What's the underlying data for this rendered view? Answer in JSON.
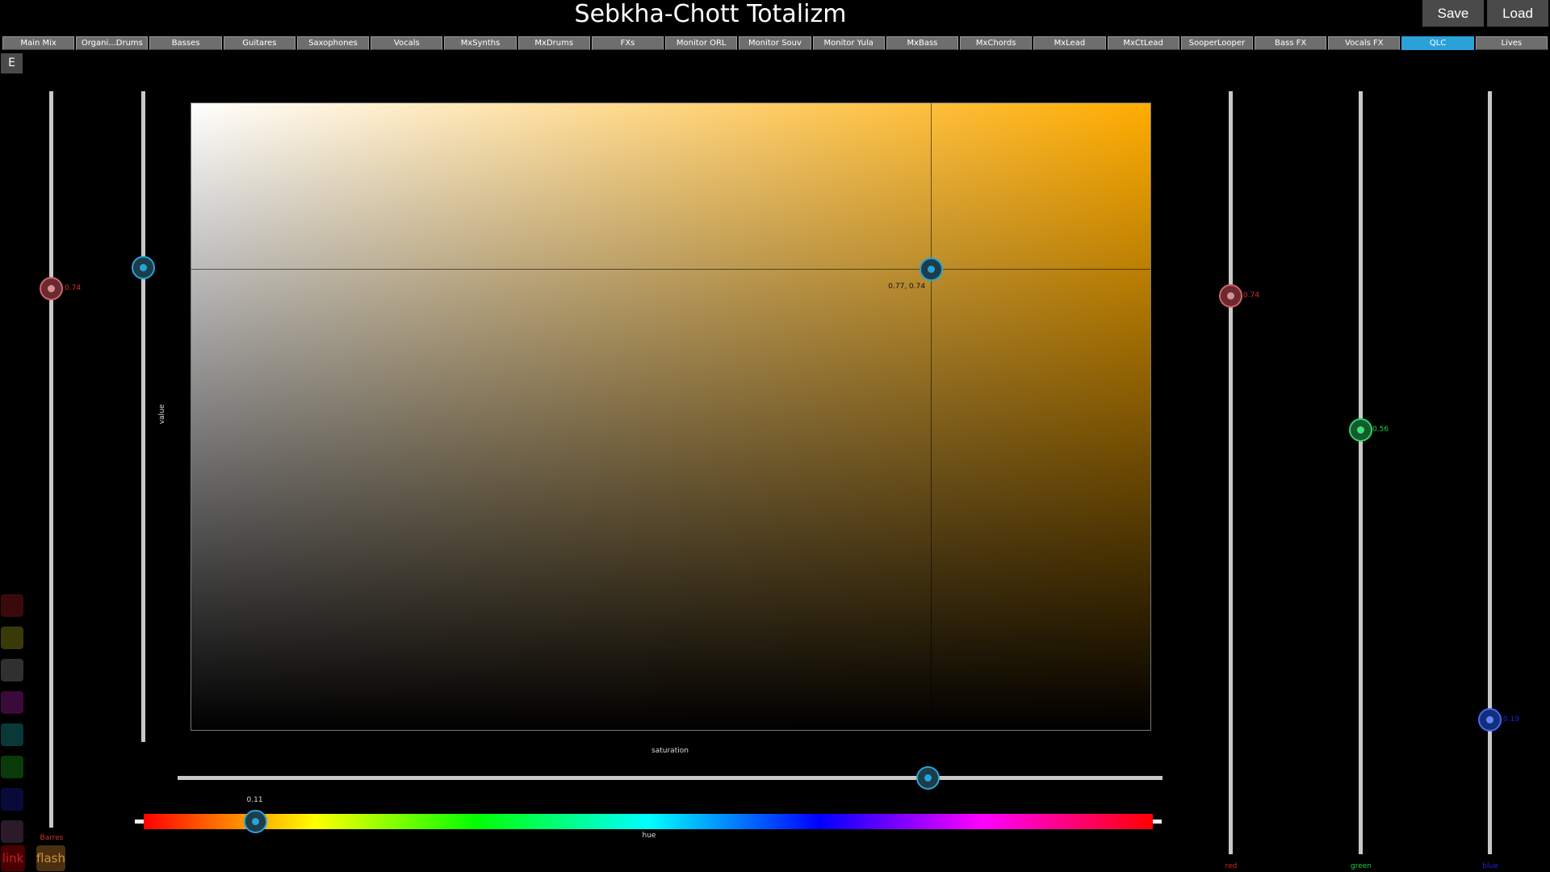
{
  "header": {
    "title": "Sebkha-Chott Totalizm",
    "save_label": "Save",
    "load_label": "Load"
  },
  "tabs": [
    {
      "label": "Main Mix"
    },
    {
      "label": "Organi...Drums"
    },
    {
      "label": "Basses"
    },
    {
      "label": "Guitares"
    },
    {
      "label": "Saxophones"
    },
    {
      "label": "Vocals"
    },
    {
      "label": "MxSynths"
    },
    {
      "label": "MxDrums"
    },
    {
      "label": "FXs"
    },
    {
      "label": "Monitor ORL"
    },
    {
      "label": "Monitor Souv"
    },
    {
      "label": "Monitor Yula"
    },
    {
      "label": "MxBass"
    },
    {
      "label": "MxChords"
    },
    {
      "label": "MxLead"
    },
    {
      "label": "MxCtLead"
    },
    {
      "label": "SooperLooper"
    },
    {
      "label": "Bass FX"
    },
    {
      "label": "Vocals FX"
    },
    {
      "label": "QLC",
      "active": true
    },
    {
      "label": "Lives"
    }
  ],
  "edit_button": "E",
  "left_fader": {
    "value": 0.74,
    "value_text": "0.74",
    "label": "Barres",
    "color": "#d03030"
  },
  "value_slider": {
    "label": "value",
    "value": 0.74
  },
  "picker": {
    "saturation": 0.77,
    "value": 0.74,
    "coords_text": "0.77, 0.74",
    "hue_color": "#ffac00"
  },
  "saturation_slider": {
    "label": "saturation",
    "value": 0.77
  },
  "hue_slider": {
    "label": "hue",
    "value": 0.11,
    "value_text": "0.11"
  },
  "rgb": {
    "red": {
      "label": "red",
      "value": 0.74,
      "value_text": "0.74",
      "color": "#d02020"
    },
    "green": {
      "label": "green",
      "value": 0.56,
      "value_text": "0.56",
      "color": "#20d040"
    },
    "blue": {
      "label": "blue",
      "value": 0.19,
      "value_text": "0.19",
      "color": "#2020e0"
    }
  },
  "swatches": [
    {
      "name": "red",
      "color": "#3a0a0a"
    },
    {
      "name": "yellow",
      "color": "#3a3a08"
    },
    {
      "name": "grey",
      "color": "#303030"
    },
    {
      "name": "magenta",
      "color": "#3a0a3a"
    },
    {
      "name": "teal",
      "color": "#083838"
    },
    {
      "name": "green",
      "color": "#0a3a0a"
    },
    {
      "name": "navy",
      "color": "#0a0a3a"
    },
    {
      "name": "purple",
      "color": "#2a1a2a"
    }
  ],
  "bottom_buttons": {
    "link_label": "link",
    "flash_label": "flash"
  }
}
